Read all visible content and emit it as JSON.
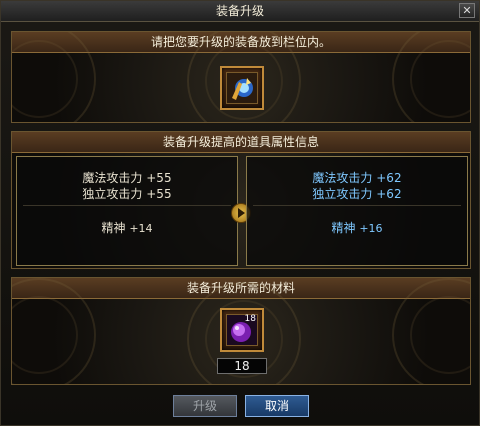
{
  "window": {
    "title": "装备升级",
    "close_icon": "close-icon"
  },
  "slot_section": {
    "instruction": "请把您要升级的装备放到栏位内。",
    "item_icon": "equipment-item-icon"
  },
  "attributes_section": {
    "title": "装备升级提高的道具属性信息",
    "current": {
      "attrs": [
        {
          "name": "魔法攻击力",
          "value": "+55"
        },
        {
          "name": "独立攻击力",
          "value": "+55"
        }
      ],
      "spirit": {
        "name": "精神",
        "value": "+14"
      }
    },
    "upgraded": {
      "attrs": [
        {
          "name": "魔法攻击力",
          "value": "+62"
        },
        {
          "name": "独立攻击力",
          "value": "+62"
        }
      ],
      "spirit": {
        "name": "精神",
        "value": "+16"
      }
    },
    "arrow_icon": "arrow-right-icon",
    "highlight_color": "#7fc8ff"
  },
  "materials_section": {
    "title": "装备升级所需的材料",
    "material": {
      "icon": "purple-gem-icon",
      "badge_count": "18",
      "count": "18"
    }
  },
  "buttons": {
    "upgrade": "升级",
    "cancel": "取消"
  }
}
